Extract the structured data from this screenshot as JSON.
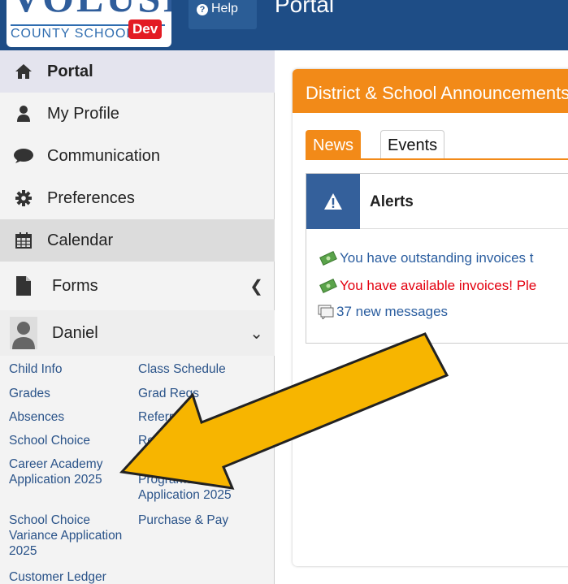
{
  "header": {
    "logo_text": "VOLUSIA",
    "logo_subtext": "COUNTY SCHOOLS",
    "env_badge": "Dev",
    "help_label": "Help",
    "title": "Portal"
  },
  "sidebar": {
    "items": [
      {
        "label": "Portal",
        "icon": "home-icon"
      },
      {
        "label": "My Profile",
        "icon": "user-icon"
      },
      {
        "label": "Communication",
        "icon": "chat-bubble-icon"
      },
      {
        "label": "Preferences",
        "icon": "gear-icon"
      },
      {
        "label": "Calendar",
        "icon": "calendar-icon"
      },
      {
        "label": "Forms",
        "icon": "document-icon"
      },
      {
        "label": "Daniel",
        "icon": "avatar-icon"
      }
    ],
    "student_links": [
      "Child Info",
      "Class Schedule",
      "Grades",
      "Grad Reqs",
      "Absences",
      "Referrals",
      "School Choice",
      "Registration",
      "Career Academy Application 2025",
      "Specialized Programs Application 2025",
      "School Choice Variance Application 2025",
      "Purchase & Pay",
      "Customer Ledger"
    ]
  },
  "main": {
    "panel_title": "District & School Announcements",
    "tabs": [
      "News",
      "Events"
    ],
    "alerts_title": "Alerts",
    "alerts": [
      {
        "text": "You have outstanding invoices t",
        "color": "#2a5d9f"
      },
      {
        "text": "You have available invoices! Ple",
        "color": "#e3000f"
      },
      {
        "text": "37 new messages",
        "color": "#2a5d9f"
      }
    ]
  },
  "colors": {
    "header_bg": "#1e4d86",
    "accent_orange": "#f28a18",
    "link_blue": "#2a5389",
    "arrow_fill": "#f7b500"
  }
}
